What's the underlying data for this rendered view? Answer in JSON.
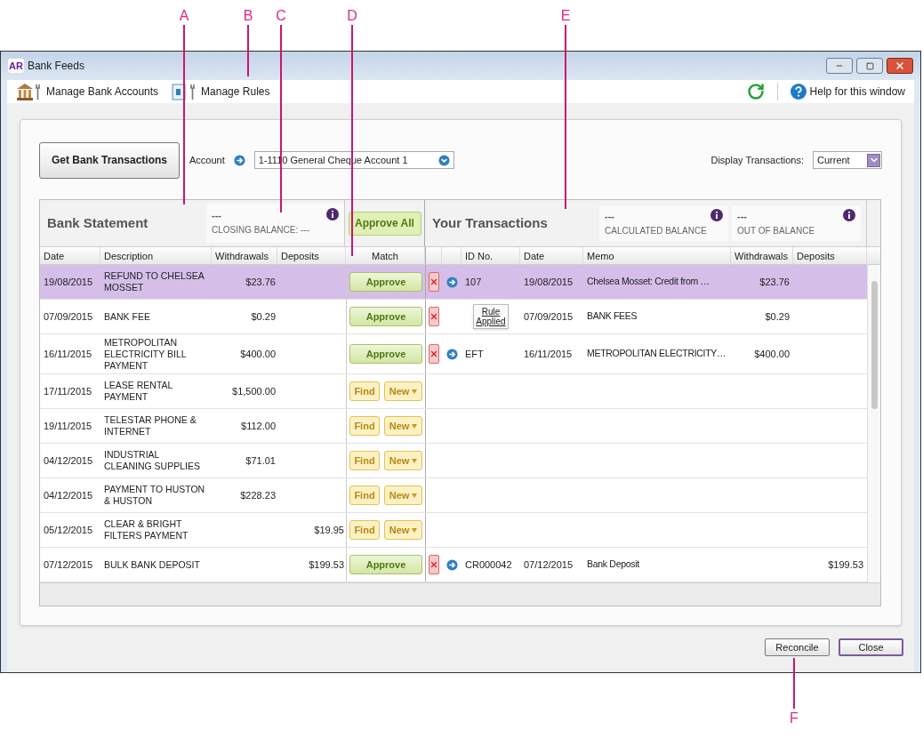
{
  "callouts_top": [
    "A",
    "B",
    "C",
    "D",
    "E"
  ],
  "callouts_bottom": [
    "F"
  ],
  "window": {
    "badge": "AR",
    "title": "Bank Feeds"
  },
  "toolbar": {
    "left": [
      "Manage Bank Accounts",
      "Manage Rules"
    ],
    "help": "Help for this window"
  },
  "controls": {
    "get_button": "Get Bank Transactions",
    "account_label": "Account",
    "account_value": "1-1110 General Cheque Account 1",
    "display_label": "Display Transactions:",
    "display_value": "Current"
  },
  "bank_statement": {
    "title": "Bank Statement",
    "balance_value": "---",
    "balance_label": "CLOSING BALANCE: ---",
    "approve_all": "Approve All",
    "columns": [
      "Date",
      "Description",
      "Withdrawals",
      "Deposits",
      "Match"
    ]
  },
  "your_transactions": {
    "title": "Your Transactions",
    "balances": [
      {
        "value": "---",
        "label": "CALCULATED BALANCE"
      },
      {
        "value": "---",
        "label": "OUT OF BALANCE"
      }
    ],
    "columns": [
      "ID No.",
      "Date",
      "Memo",
      "Withdrawals",
      "Deposits"
    ]
  },
  "rows": [
    {
      "selected": true,
      "date": "19/08/2015",
      "description": "REFUND TO CHELSEA MOSSET",
      "withdrawals": "$23.76",
      "match": {
        "kind": "approve",
        "label": "Approve"
      },
      "transaction": {
        "kind": "linked",
        "id": "107",
        "date": "19/08/2015",
        "memo": "Chelsea Mosset:  Credit from …",
        "withdrawals": "$23.76"
      }
    },
    {
      "selected": false,
      "date": "07/09/2015",
      "description": "BANK FEE",
      "withdrawals": "$0.29",
      "match": {
        "kind": "approve",
        "label": "Approve"
      },
      "transaction": {
        "kind": "rule",
        "rule_label": "Rule Applied",
        "date": "07/09/2015",
        "memo": "BANK FEES",
        "withdrawals": "$0.29"
      }
    },
    {
      "selected": false,
      "date": "16/11/2015",
      "description": "METROPOLITAN ELECTRICITY BILL PAYMENT",
      "withdrawals": "$400.00",
      "match": {
        "kind": "approve",
        "label": "Approve"
      },
      "transaction": {
        "kind": "linked",
        "id": "EFT",
        "date": "16/11/2015",
        "memo": "METROPOLITAN ELECTRICITY…",
        "withdrawals": "$400.00"
      }
    },
    {
      "selected": false,
      "date": "17/11/2015",
      "description": "LEASE RENTAL PAYMENT",
      "withdrawals": "$1,500.00",
      "match": {
        "kind": "find_new",
        "find": "Find",
        "new": "New"
      }
    },
    {
      "selected": false,
      "date": "19/11/2015",
      "description": "TELESTAR PHONE & INTERNET",
      "withdrawals": "$112.00",
      "match": {
        "kind": "find_new",
        "find": "Find",
        "new": "New"
      }
    },
    {
      "selected": false,
      "date": "04/12/2015",
      "description": "INDUSTRIAL CLEANING SUPPLIES",
      "withdrawals": "$71.01",
      "match": {
        "kind": "find_new",
        "find": "Find",
        "new": "New"
      }
    },
    {
      "selected": false,
      "date": "04/12/2015",
      "description": "PAYMENT TO HUSTON & HUSTON",
      "withdrawals": "$228.23",
      "match": {
        "kind": "find_new",
        "find": "Find",
        "new": "New"
      }
    },
    {
      "selected": false,
      "date": "05/12/2015",
      "description": "CLEAR & BRIGHT FILTERS PAYMENT",
      "deposits": "$19.95",
      "match": {
        "kind": "find_new",
        "find": "Find",
        "new": "New"
      }
    },
    {
      "selected": false,
      "date": "07/12/2015",
      "description": "BULK BANK DEPOSIT",
      "deposits": "$199.53",
      "match": {
        "kind": "approve",
        "label": "Approve"
      },
      "transaction": {
        "kind": "linked",
        "id": "CR000042",
        "date": "07/12/2015",
        "memo": "Bank Deposit",
        "deposits": "$199.53"
      }
    }
  ],
  "footer_buttons": [
    "Reconcile",
    "Close"
  ]
}
